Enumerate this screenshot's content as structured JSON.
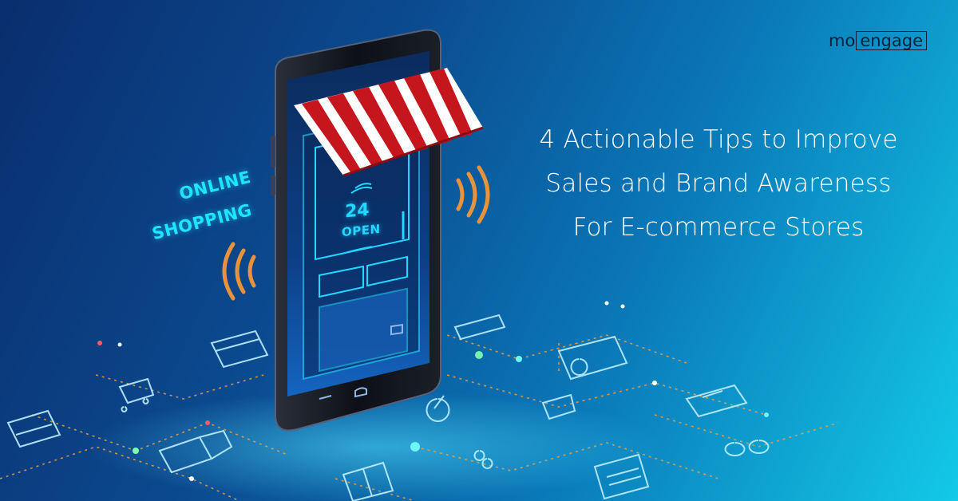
{
  "headline": {
    "line1": "4 Actionable Tips to Improve",
    "line2": "Sales and Brand Awareness",
    "line3": "For E-commerce Stores"
  },
  "logo": {
    "part1": "mo",
    "part2": "engage"
  },
  "tag": {
    "line1": "ONLINE",
    "line2": "SHOPPING"
  },
  "door_sign": {
    "number": "24",
    "label": "OPEN"
  },
  "colors": {
    "bg_dark": "#0a2e6e",
    "bg_light": "#13c9e8",
    "neon": "#23d7ff",
    "awning_red": "#c4161c",
    "wifi_orange": "#e8923a",
    "path_orange": "#f0a040"
  },
  "icons": [
    "wifi-icon",
    "delivery-truck-icon",
    "shopping-cart-icon",
    "credit-card-icon",
    "gift-box-icon",
    "calculator-icon",
    "cash-register-icon",
    "car-icon",
    "coins-icon",
    "laptop-icon",
    "percent-icon",
    "handshake-icon"
  ]
}
